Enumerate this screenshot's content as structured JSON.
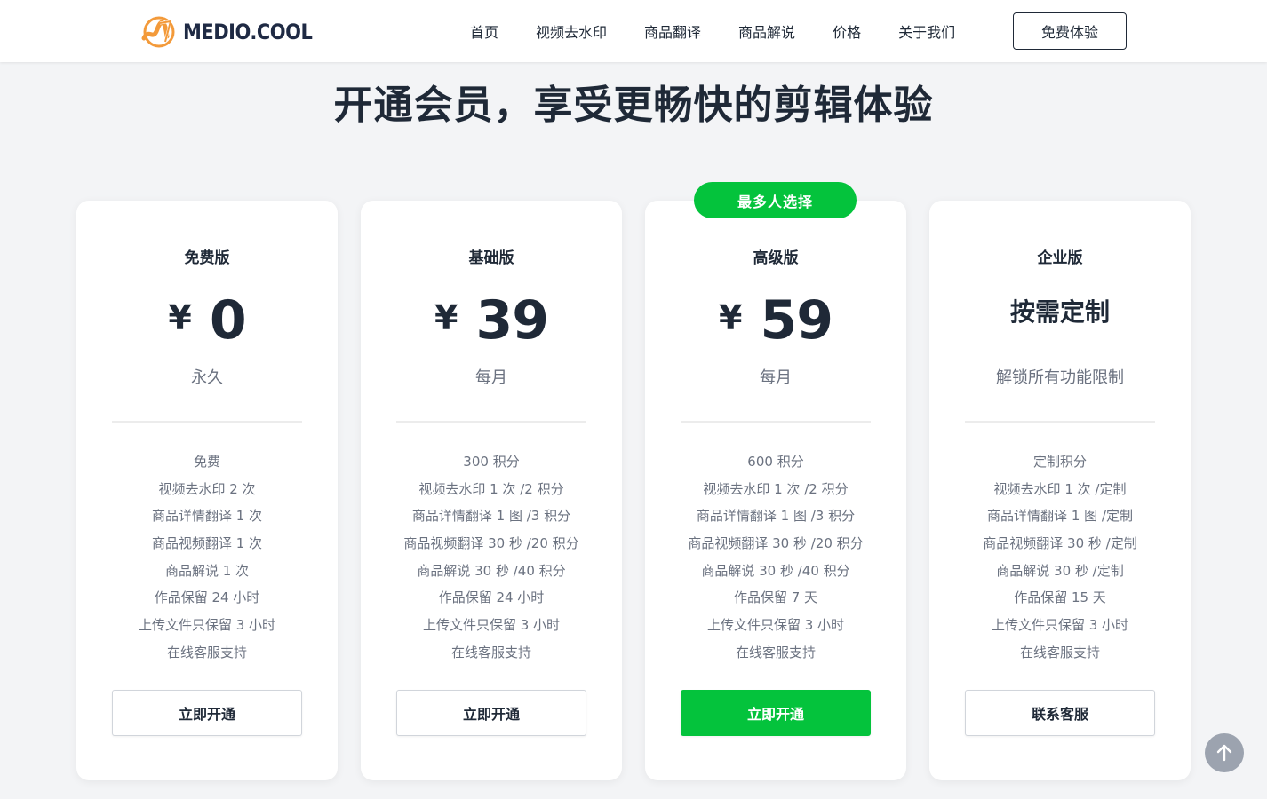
{
  "brand": {
    "name": "MEDIO.COOL",
    "accent": "#f39a3a",
    "green": "#04c33c"
  },
  "nav": {
    "items": [
      "首页",
      "视频去水印",
      "商品翻译",
      "商品解说",
      "价格",
      "关于我们"
    ],
    "cta": "免费体验"
  },
  "hero": {
    "title": "开通会员，享受更畅快的剪辑体验"
  },
  "plans": [
    {
      "name": "免费版",
      "currency": "¥",
      "price": "0",
      "period": "永久",
      "features": [
        "免费",
        "视频去水印 2 次",
        "商品详情翻译 1 次",
        "商品视频翻译 1 次",
        "商品解说 1 次",
        "作品保留 24 小时",
        "上传文件只保留 3 小时",
        "在线客服支持"
      ],
      "button": "立即开通"
    },
    {
      "name": "基础版",
      "currency": "¥",
      "price": "39",
      "period": "每月",
      "features": [
        "300 积分",
        "视频去水印 1 次 /2 积分",
        "商品详情翻译 1 图 /3 积分",
        "商品视频翻译 30 秒 /20 积分",
        "商品解说 30 秒 /40 积分",
        "作品保留 24 小时",
        "上传文件只保留 3 小时",
        "在线客服支持"
      ],
      "button": "立即开通"
    },
    {
      "name": "高级版",
      "badge": "最多人选择",
      "currency": "¥",
      "price": "59",
      "period": "每月",
      "features": [
        "600 积分",
        "视频去水印 1 次 /2 积分",
        "商品详情翻译 1 图 /3 积分",
        "商品视频翻译 30 秒 /20 积分",
        "商品解说 30 秒 /40 积分",
        "作品保留 7 天",
        "上传文件只保留 3 小时",
        "在线客服支持"
      ],
      "button": "立即开通"
    },
    {
      "name": "企业版",
      "custom_price": "按需定制",
      "period": "解锁所有功能限制",
      "features": [
        "定制积分",
        "视频去水印 1 次 /定制",
        "商品详情翻译 1 图 /定制",
        "商品视频翻译 30 秒 /定制",
        "商品解说 30 秒 /定制",
        "作品保留 15 天",
        "上传文件只保留 3 小时",
        "在线客服支持"
      ],
      "button": "联系客服"
    }
  ],
  "icons": {
    "logo": "logo-icon",
    "back_to_top": "arrow-up-icon"
  }
}
